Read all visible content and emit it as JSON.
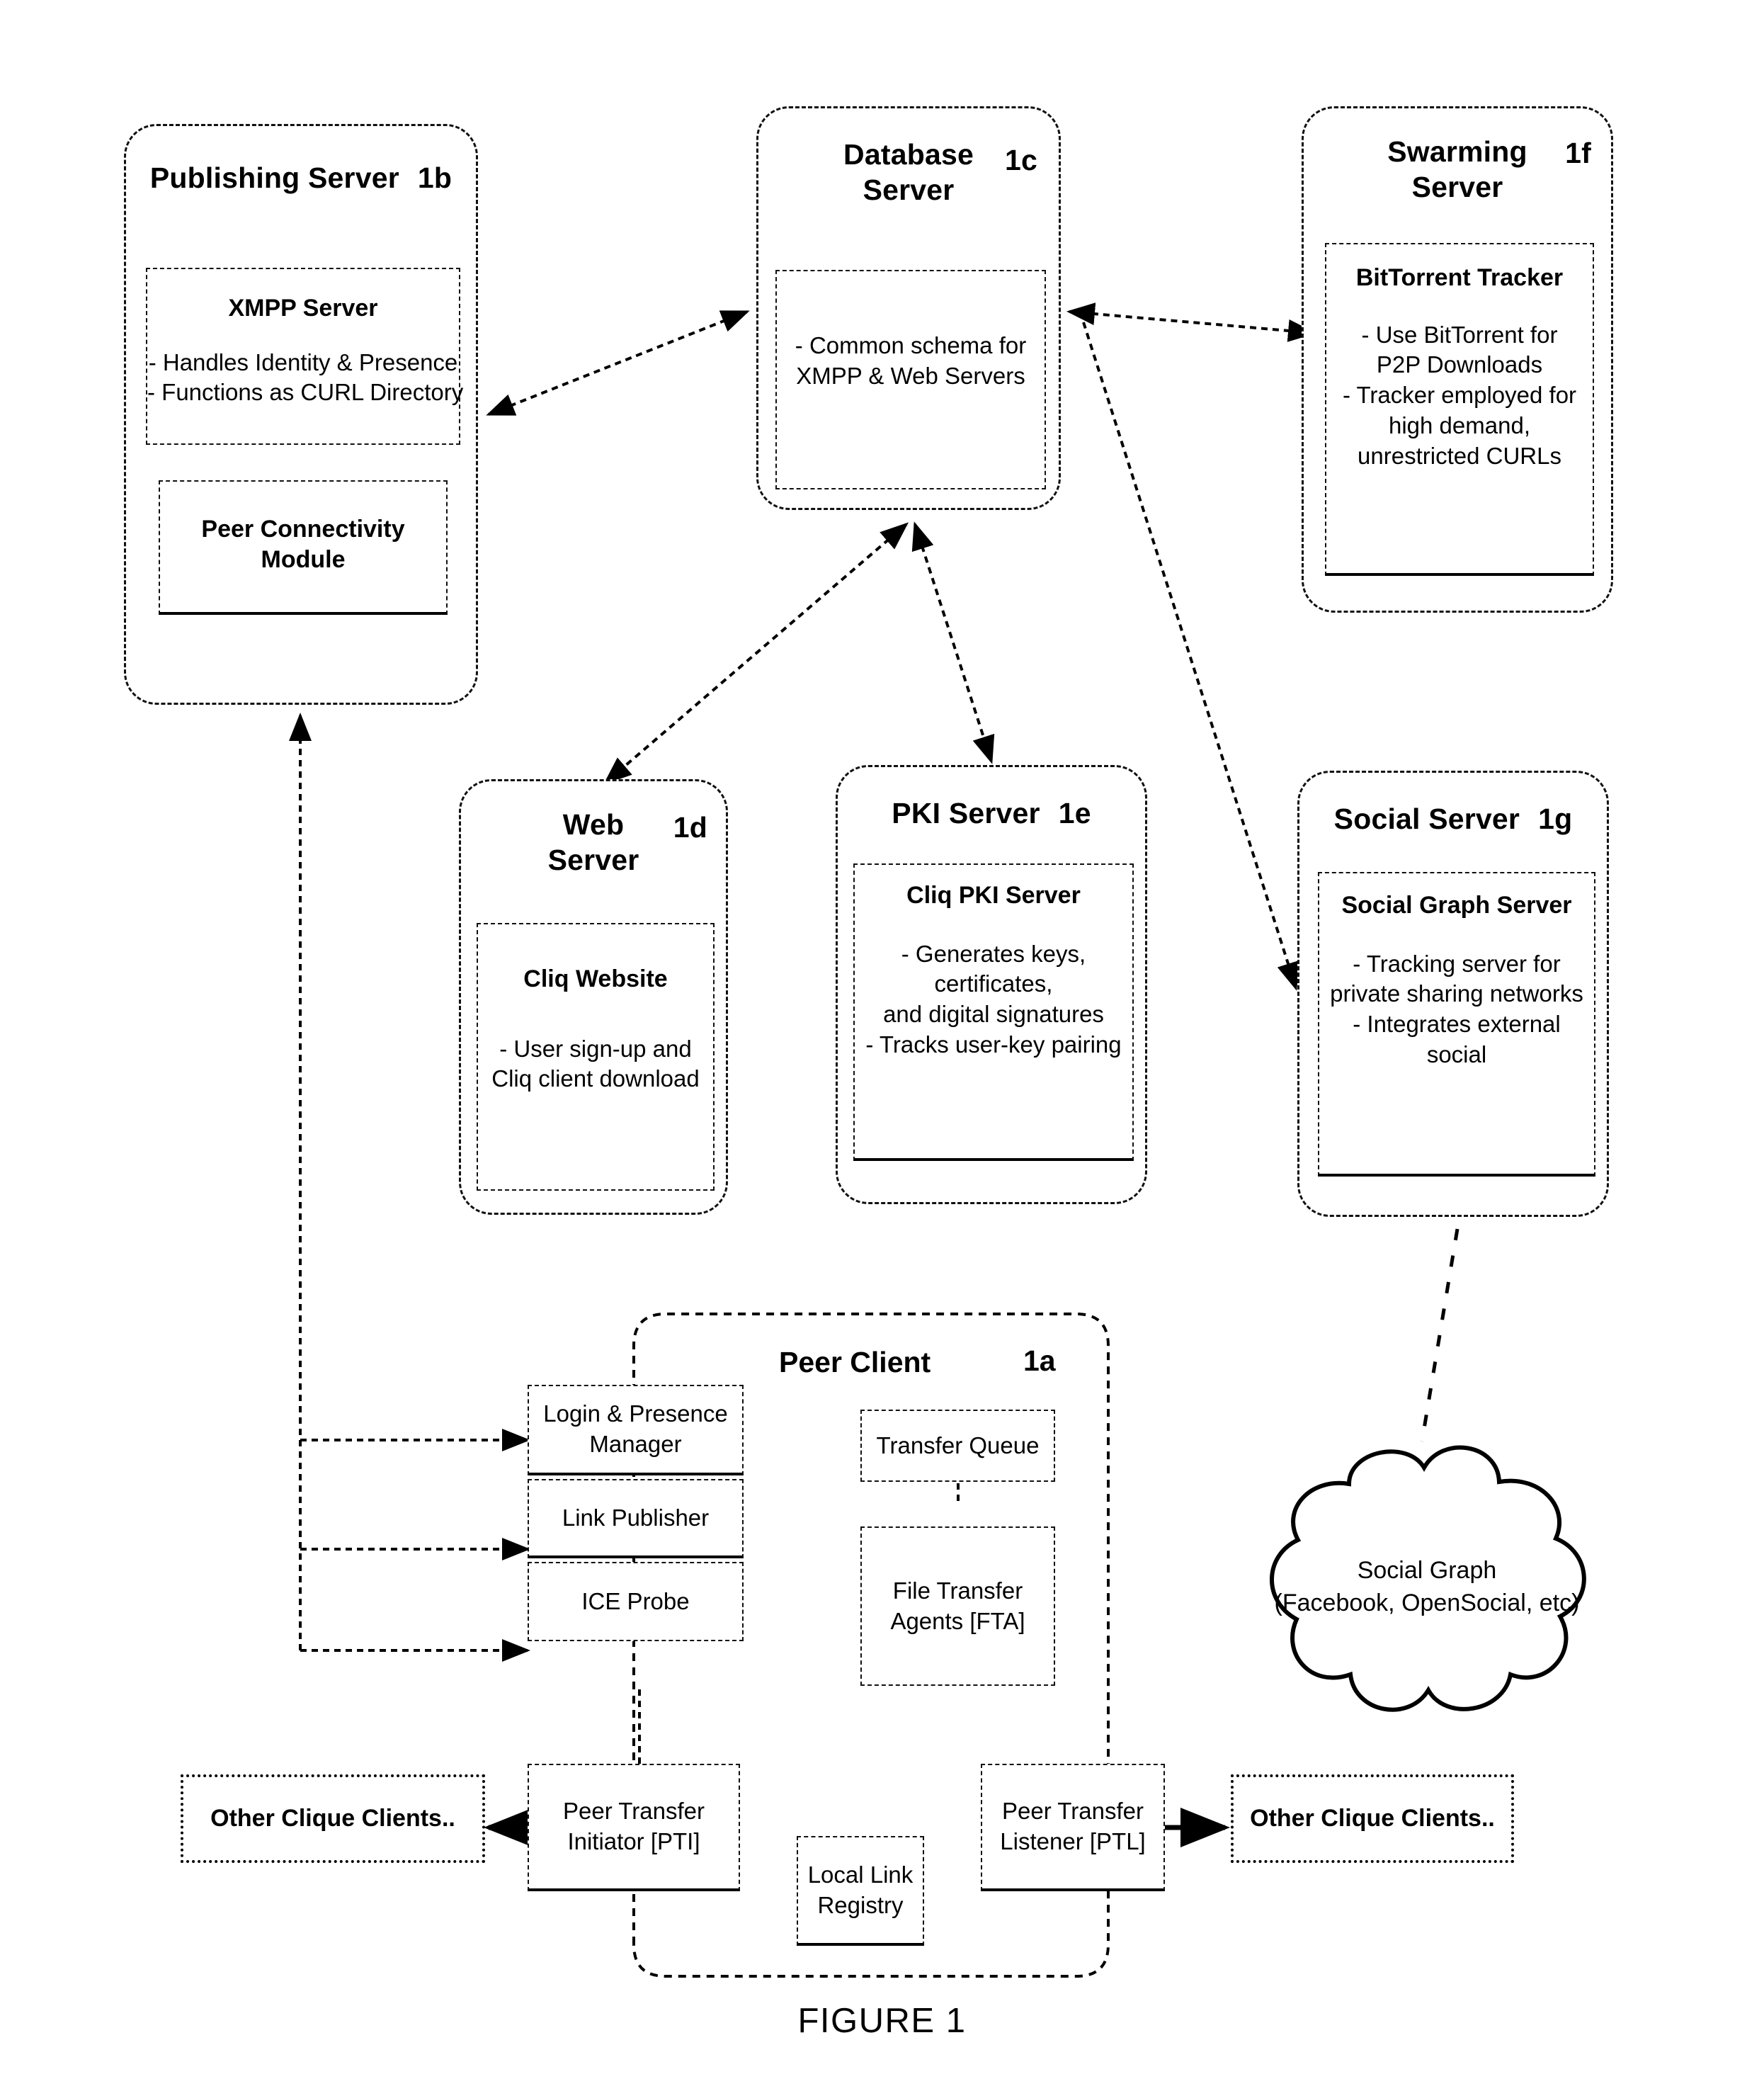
{
  "figure": {
    "caption": "FIGURE 1"
  },
  "servers": {
    "publishing": {
      "title": "Publishing Server",
      "ref": "1b",
      "modules": [
        {
          "title": "XMPP Server",
          "lines": [
            "- Handles Identity & Presence",
            "- Functions as CURL Directory"
          ]
        },
        {
          "title": "Peer Connectivity Module",
          "title_l1": "Peer Connectivity",
          "title_l2": "Module",
          "lines": []
        }
      ]
    },
    "database": {
      "title_l1": "Database",
      "title_l2": "Server",
      "ref": "1c",
      "modules": [
        {
          "title": "",
          "lines": [
            "- Common schema for",
            "XMPP & Web Servers"
          ]
        }
      ]
    },
    "swarming": {
      "title_l1": "Swarming",
      "title_l2": "Server",
      "ref": "1f",
      "modules": [
        {
          "title": "BitTorrent Tracker",
          "lines": [
            "- Use BitTorrent for",
            "P2P Downloads",
            "- Tracker employed for",
            "high demand,",
            "unrestricted CURLs"
          ]
        }
      ]
    },
    "web": {
      "title_l1": "Web",
      "title_l2": "Server",
      "ref": "1d",
      "modules": [
        {
          "title": "Cliq Website",
          "lines": [
            "- User sign-up and",
            "Cliq client download"
          ]
        }
      ]
    },
    "pki": {
      "title": "PKI Server",
      "ref": "1e",
      "modules": [
        {
          "title": "Cliq PKI Server",
          "lines": [
            "- Generates keys,",
            "certificates,",
            "and digital signatures",
            "- Tracks user-key pairing"
          ]
        }
      ]
    },
    "social": {
      "title": "Social Server",
      "ref": "1g",
      "modules": [
        {
          "title": "Social Graph Server",
          "lines": [
            "- Tracking server for",
            "private sharing networks",
            "- Integrates external",
            "social"
          ]
        }
      ]
    }
  },
  "peer_client": {
    "title": "Peer Client",
    "ref": "1a",
    "boxes": {
      "login_presence": {
        "l1": "Login & Presence",
        "l2": "Manager"
      },
      "link_publisher": {
        "l1": "Link Publisher"
      },
      "ice_probe": {
        "l1": "ICE Probe"
      },
      "transfer_queue": {
        "l1": "Transfer Queue"
      },
      "file_transfer_agents": {
        "l1": "File Transfer",
        "l2": "Agents [FTA]"
      },
      "peer_transfer_initiator": {
        "l1": "Peer Transfer",
        "l2": "Initiator [PTI]"
      },
      "peer_transfer_listener": {
        "l1": "Peer Transfer",
        "l2": "Listener [PTL]"
      },
      "local_link_registry": {
        "l1": "Local Link",
        "l2": "Registry"
      }
    }
  },
  "external": {
    "other_clients_left": "Other Clique Clients..",
    "other_clients_right": "Other Clique Clients..",
    "cloud": {
      "l1": "Social Graph",
      "l2": "(Facebook, OpenSocial, etc)"
    }
  },
  "colors": {
    "ink": "#000000",
    "paper": "#ffffff"
  }
}
